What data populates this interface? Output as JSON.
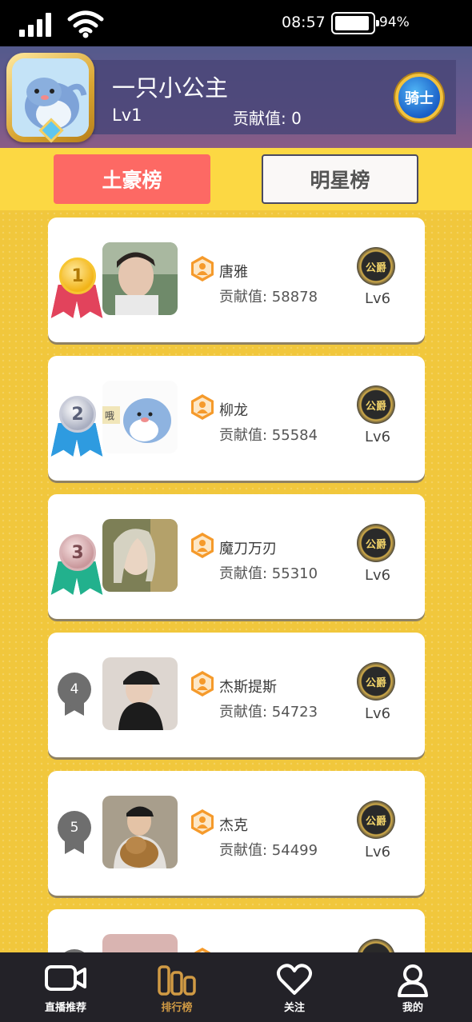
{
  "status_bar": {
    "time": "08:57",
    "battery": "94%",
    "battery_level": 0.94
  },
  "profile": {
    "name": "一只小公主",
    "level": "Lv1",
    "contribution": "贡献值: 0",
    "badge": "骑士"
  },
  "tabs": [
    {
      "label": "土豪榜",
      "active": true
    },
    {
      "label": "明星榜",
      "active": false
    }
  ],
  "rankings": [
    {
      "rank": "1",
      "name": "唐雅",
      "contribution": "贡献值: 58878",
      "badge": "公爵",
      "level": "Lv6",
      "medal": "gold"
    },
    {
      "rank": "2",
      "name": "柳龙",
      "contribution": "贡献值: 55584",
      "badge": "公爵",
      "level": "Lv6",
      "medal": "silver"
    },
    {
      "rank": "3",
      "name": "魔刀万刃",
      "contribution": "贡献值: 55310",
      "badge": "公爵",
      "level": "Lv6",
      "medal": "bronze"
    },
    {
      "rank": "4",
      "name": "杰斯提斯",
      "contribution": "贡献值: 54723",
      "badge": "公爵",
      "level": "Lv6",
      "medal": "plain"
    },
    {
      "rank": "5",
      "name": "杰克",
      "contribution": "贡献值: 54499",
      "badge": "公爵",
      "level": "Lv6",
      "medal": "plain"
    },
    {
      "rank": "",
      "name": "",
      "contribution": "",
      "badge": "",
      "level": "",
      "medal": "plain"
    }
  ],
  "bottom_nav": [
    {
      "label": "直播推荐",
      "icon": "video-camera-icon",
      "active": false
    },
    {
      "label": "排行榜",
      "icon": "ranking-bars-icon",
      "active": true
    },
    {
      "label": "关注",
      "icon": "heart-icon",
      "active": false
    },
    {
      "label": "我的",
      "icon": "person-icon",
      "active": false
    }
  ],
  "colors": {
    "active_tab": "#fd6964",
    "active_nav": "#d09a44",
    "list_bg": "#f1c73c",
    "tab_strip": "#fcd843"
  }
}
